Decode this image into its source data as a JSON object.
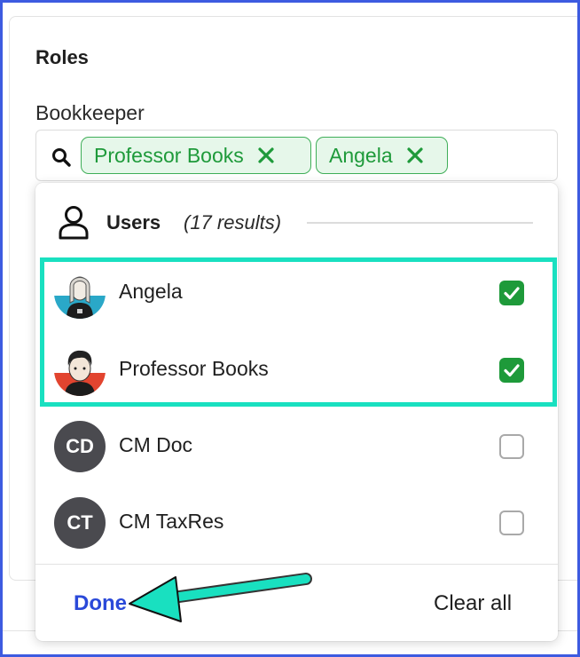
{
  "section": {
    "title": "Roles"
  },
  "field": {
    "label": "Bookkeeper",
    "chips": [
      {
        "label": "Professor Books"
      },
      {
        "label": "Angela"
      }
    ]
  },
  "dropdown": {
    "group_title": "Users",
    "group_count": "(17 results)",
    "items": [
      {
        "name": "Angela",
        "checked": true
      },
      {
        "name": "Professor Books",
        "checked": true
      },
      {
        "name": "CM Doc",
        "initials": "CD",
        "checked": false
      },
      {
        "name": "CM TaxRes",
        "initials": "CT",
        "checked": false
      }
    ],
    "done_label": "Done",
    "clear_label": "Clear all"
  },
  "colors": {
    "chip_bg": "#e6f7ea",
    "chip_green": "#1e9a3a",
    "highlight": "#19e0c0",
    "done_blue": "#2a49d9",
    "frame_blue": "#3d5be0",
    "initials_avatar": "#4a4a4f"
  },
  "icons": [
    "search-icon",
    "close-icon",
    "user-icon",
    "checkmark-icon",
    "arrow-annotation"
  ]
}
